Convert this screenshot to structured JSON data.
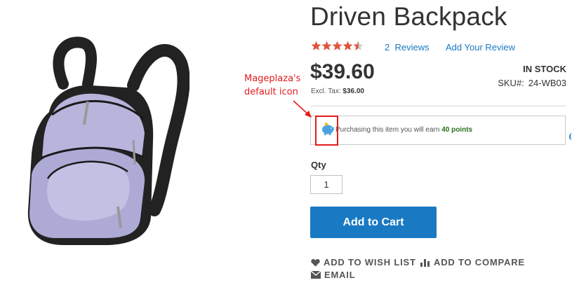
{
  "product": {
    "name": "Driven Backpack",
    "rating_stars": 4.5,
    "reviews_count": "2",
    "reviews_label": "Reviews",
    "add_review_label": "Add Your Review",
    "price": "$39.60",
    "excl_tax_label": "Excl. Tax:",
    "excl_tax_value": "$36.00",
    "stock_status": "In stock",
    "sku_label": "SKU#:",
    "sku_value": "24-WB03"
  },
  "reward_points": {
    "text_prefix": "Purchasing this item you will earn",
    "points_text": "40 points",
    "icon": "piggy-bank-icon"
  },
  "annotation": {
    "line1": "Mageplaza's",
    "line2": "default icon"
  },
  "purchase": {
    "qty_label": "Qty",
    "qty_value": "1",
    "add_to_cart_label": "Add to Cart"
  },
  "actions": {
    "wishlist_label": "ADD TO WISH LIST",
    "compare_label": "ADD TO COMPARE",
    "email_label": "EMAIL"
  },
  "colors": {
    "accent": "#1979c3",
    "star": "#e0533c",
    "annotation": "#e21b1b",
    "points": "#2a6f1f"
  }
}
